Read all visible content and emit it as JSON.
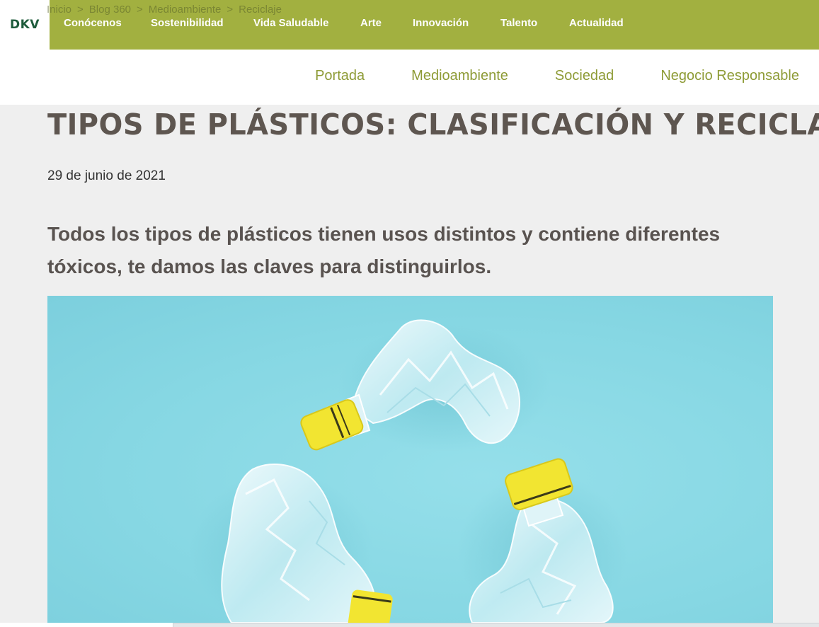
{
  "logo": {
    "text": "DKV"
  },
  "breadcrumb": [
    "Inicio",
    "Blog 360",
    "Medioambiente",
    "Reciclaje"
  ],
  "main_nav": [
    "Conócenos",
    "Sostenibilidad",
    "Vida Saludable",
    "Arte",
    "Innovación",
    "Talento",
    "Actualidad"
  ],
  "sub_nav": [
    "Portada",
    "Medioambiente",
    "Sociedad",
    "Negocio Responsable"
  ],
  "article": {
    "title": "TIPOS DE PLÁSTICOS: CLASIFICACIÓN Y RECICLAJE",
    "date": "29 de junio de 2021",
    "lead": "Todos los tipos de plásticos tienen usos distintos y contiene diferentes tóxicos, te damos las claves para distinguirlos."
  },
  "colors": {
    "nav_green": "#a2b040",
    "sub_nav_text": "#8e9b36",
    "title_text": "#5e5650",
    "hero_bg": "#86d7e3",
    "bottle_cap": "#f2e531"
  }
}
